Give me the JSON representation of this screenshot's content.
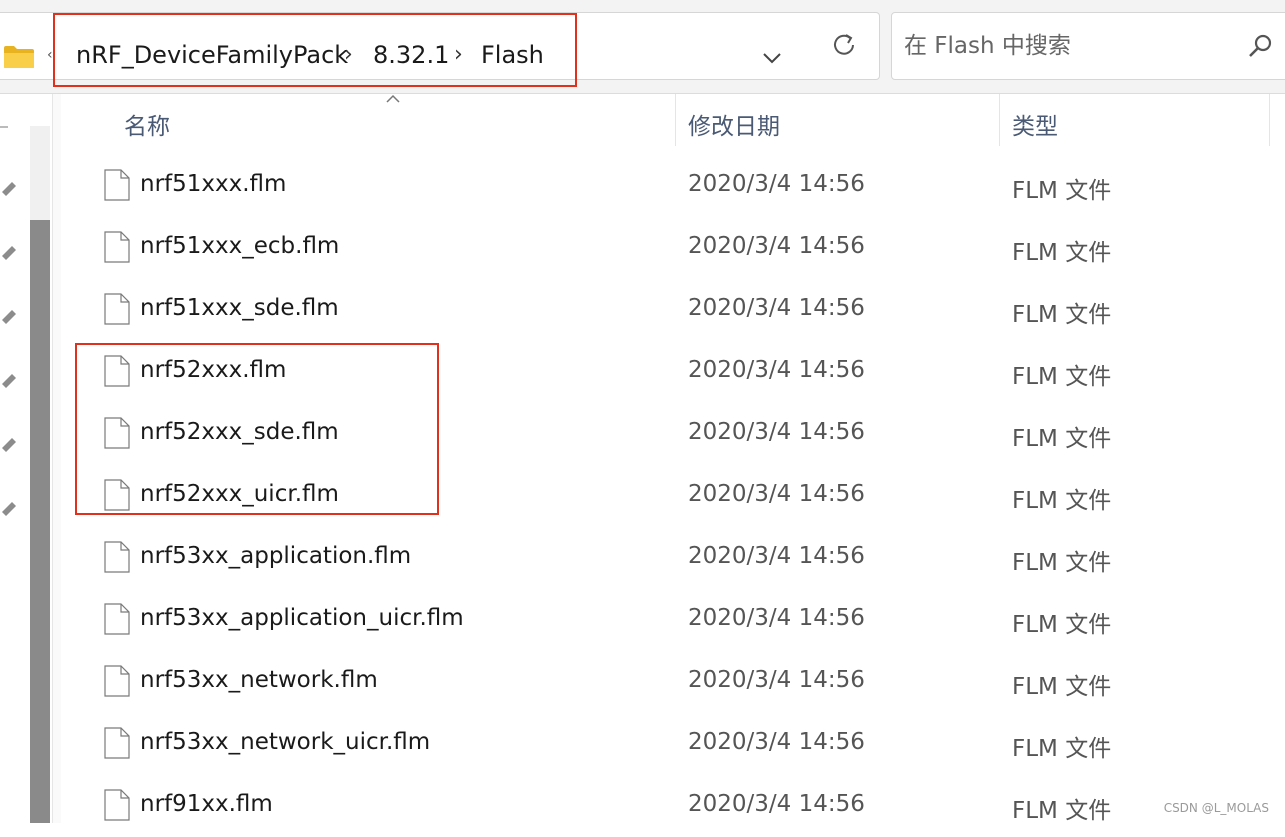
{
  "address_bar": {
    "path": [
      "nRF_DeviceFamilyPack",
      "8.32.1",
      "Flash"
    ],
    "separator": "›"
  },
  "search": {
    "placeholder": "在 Flash 中搜索"
  },
  "columns": {
    "name": "名称",
    "modified": "修改日期",
    "type": "类型"
  },
  "files": [
    {
      "name": "nrf51xxx.flm",
      "modified": "2020/3/4 14:56",
      "type": "FLM 文件"
    },
    {
      "name": "nrf51xxx_ecb.flm",
      "modified": "2020/3/4 14:56",
      "type": "FLM 文件"
    },
    {
      "name": "nrf51xxx_sde.flm",
      "modified": "2020/3/4 14:56",
      "type": "FLM 文件"
    },
    {
      "name": "nrf52xxx.flm",
      "modified": "2020/3/4 14:56",
      "type": "FLM 文件"
    },
    {
      "name": "nrf52xxx_sde.flm",
      "modified": "2020/3/4 14:56",
      "type": "FLM 文件"
    },
    {
      "name": "nrf52xxx_uicr.flm",
      "modified": "2020/3/4 14:56",
      "type": "FLM 文件"
    },
    {
      "name": "nrf53xx_application.flm",
      "modified": "2020/3/4 14:56",
      "type": "FLM 文件"
    },
    {
      "name": "nrf53xx_application_uicr.flm",
      "modified": "2020/3/4 14:56",
      "type": "FLM 文件"
    },
    {
      "name": "nrf53xx_network.flm",
      "modified": "2020/3/4 14:56",
      "type": "FLM 文件"
    },
    {
      "name": "nrf53xx_network_uicr.flm",
      "modified": "2020/3/4 14:56",
      "type": "FLM 文件"
    },
    {
      "name": "nrf91xx.flm",
      "modified": "2020/3/4 14:56",
      "type": "FLM 文件"
    }
  ],
  "watermark": "CSDN @L_MOLAS",
  "colors": {
    "annotation": "#e2301c",
    "folder": "#f4c542",
    "header_text": "#4a5a75"
  },
  "icons": {
    "folder": "folder-icon",
    "dropdown": "chevron-down-icon",
    "refresh": "refresh-icon",
    "search": "search-icon",
    "file": "file-icon",
    "pin": "pin-icon"
  }
}
